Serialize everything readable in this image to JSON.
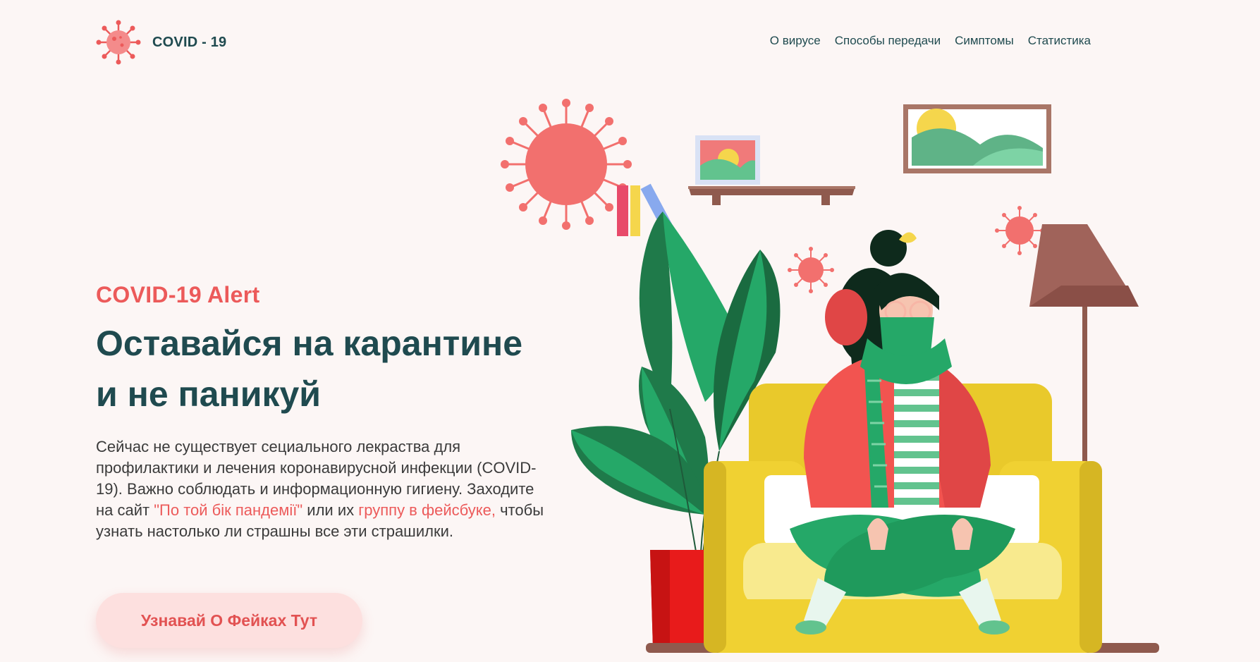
{
  "header": {
    "logo_text": "COVID - 19",
    "nav": [
      {
        "label": "О вирусе"
      },
      {
        "label": "Способы передачи"
      },
      {
        "label": "Симптомы"
      },
      {
        "label": "Статистика"
      }
    ]
  },
  "hero": {
    "alert": "COVID-19 Alert",
    "title_line1": "Оставайся на карантине",
    "title_line2": "и не паникуй",
    "desc_part1": "Сейчас не существует сециального лекраства для профилактики и лечения коронавирусной инфекции (COVID-19). Важно соблюдать и информационную гигиену. Заходите на сайт ",
    "desc_link1": "\"По той бік пандемії\"",
    "desc_part2": " или их ",
    "desc_link2": "группу в фейсбуке,",
    "desc_part3": " чтобы узнать настолько ли страшны все эти страшилки.",
    "cta_label": "Узнавай О Фейках Тут"
  },
  "colors": {
    "accent": "#ec5a5a",
    "heading": "#1f4a4f",
    "background": "#fcf6f5",
    "cta_bg": "#fde0df"
  },
  "icons": {
    "logo": "virus-icon"
  }
}
